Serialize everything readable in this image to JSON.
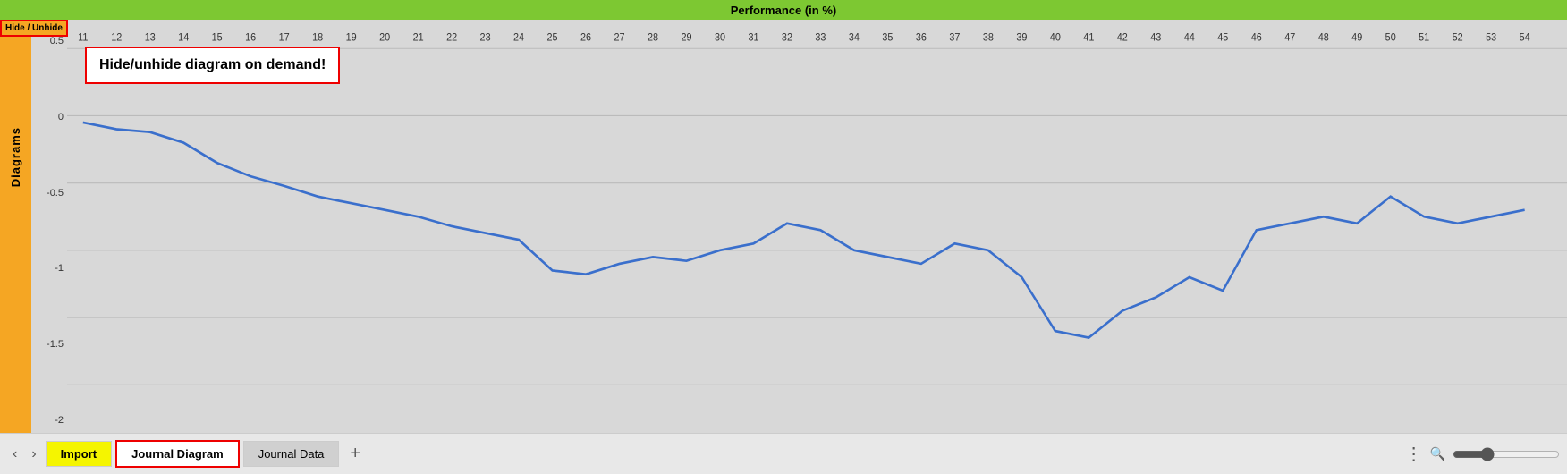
{
  "topbar": {
    "title": "Performance (in %)"
  },
  "sidebar": {
    "hide_unhide_label": "Hide / Unhide",
    "diagrams_label": "Diagrams"
  },
  "tooltip": {
    "line1": "Hide/unhide diagram on demand!"
  },
  "chart": {
    "y_axis": [
      "0.5",
      "0",
      "-0.5",
      "-1",
      "-1.5",
      "-2"
    ],
    "x_labels": [
      "11",
      "12",
      "13",
      "14",
      "15",
      "16",
      "17",
      "18",
      "19",
      "20",
      "21",
      "22",
      "23",
      "24",
      "25",
      "26",
      "27",
      "28",
      "29",
      "30",
      "31",
      "32",
      "33",
      "34",
      "35",
      "36",
      "37",
      "38",
      "39",
      "40",
      "41",
      "42",
      "43",
      "44",
      "45",
      "46",
      "47",
      "48",
      "49",
      "50",
      "51",
      "52",
      "53",
      "54"
    ]
  },
  "tabs": {
    "nav_prev": "‹",
    "nav_next": "›",
    "import_label": "Import",
    "journal_diagram_label": "Journal Diagram",
    "journal_data_label": "Journal Data",
    "add_label": "+",
    "more_label": "⋮"
  }
}
